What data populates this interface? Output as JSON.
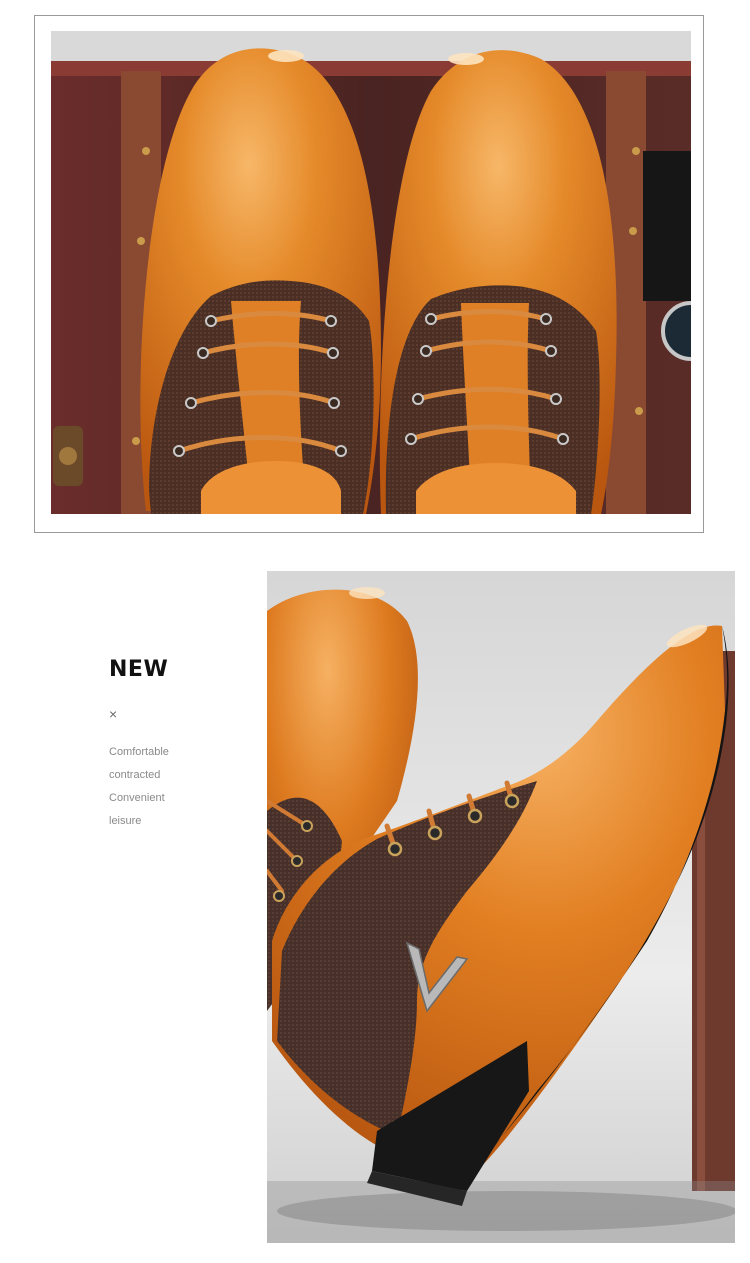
{
  "caption": {
    "title": "NEW",
    "separator": "×",
    "features": [
      "Comfortable",
      "contracted",
      "Convenient",
      "leisure"
    ]
  },
  "colors": {
    "leather": "#e07b1f",
    "leather_highlight": "#f6b162",
    "mesh": "#4a2e22",
    "sole": "#151515",
    "trunk": "#5e2a26",
    "background": "#ffffff",
    "frame_border": "#9a9a9a"
  },
  "images": {
    "top_photo": "pair of tan-orange leather lace-up dress shoes with brown mesh panels on a vintage trunk",
    "bottom_photo": "side view of tan-orange leather dress shoe with metal V ornament and black sole"
  }
}
